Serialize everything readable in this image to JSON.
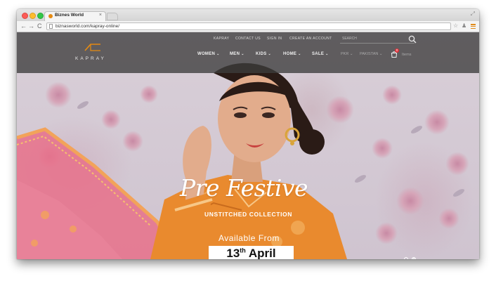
{
  "browser": {
    "tab_title": "Biznes World",
    "tab_close": "×",
    "url": "biznasworld.com/kapray-online/"
  },
  "site": {
    "logo_text": "KAPRAY",
    "topnav": [
      "KAPRAY",
      "CONTACT US",
      "SIGN IN",
      "CREATE AN ACCOUNT"
    ],
    "search_placeholder": "SEARCH",
    "mainnav": [
      "WOMEN",
      "MEN",
      "KIDS",
      "HOME",
      "SALE"
    ],
    "currency": "PKR",
    "country": "PAKISTAN",
    "cart_count": "0",
    "cart_label": "Items"
  },
  "banner": {
    "title": "Pre Festive",
    "subtitle": "UNSTITCHED COLLECTION",
    "available_label": "Available From",
    "date_day": "13",
    "date_suffix": "th",
    "date_month": "April",
    "slide_count": 2,
    "active_slide": 2
  },
  "colors": {
    "accent": "#e58a12",
    "header_overlay": "#3c3c3c",
    "badge": "#e0333b"
  }
}
